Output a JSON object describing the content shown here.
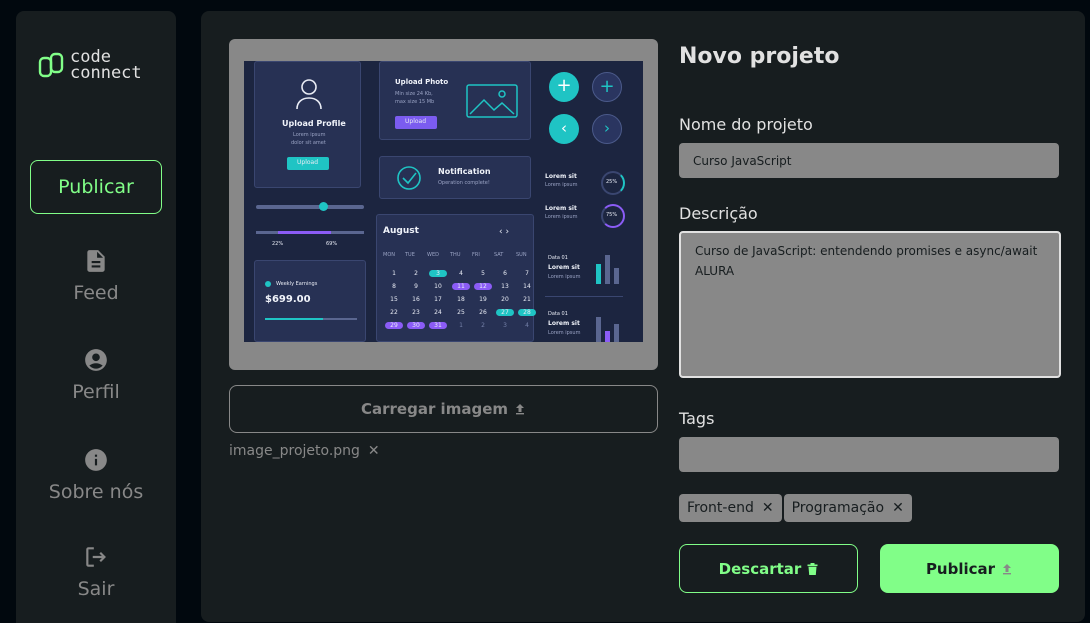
{
  "sidebar": {
    "logo_line1": "code",
    "logo_line2": "connect",
    "publish_label": "Publicar",
    "items": [
      {
        "label": "Feed",
        "icon": "document-icon"
      },
      {
        "label": "Perfil",
        "icon": "user-circle-icon"
      },
      {
        "label": "Sobre nós",
        "icon": "info-icon"
      },
      {
        "label": "Sair",
        "icon": "logout-icon"
      }
    ]
  },
  "preview": {
    "upload_label": "Carregar imagem",
    "file_name": "image_projeto.png",
    "mockup": {
      "upload_profile": "Upload Profile",
      "profile_desc1": "Lorem ipsum",
      "profile_desc2": "dolor sit amet",
      "upload_btn": "Upload",
      "upload_photo": "Upload Photo",
      "min_size": "Min size 24 Kb,",
      "max_size": "max size 15 Mb",
      "upload_btn2": "Upload",
      "notification": "Notification",
      "operation_complete": "Operation complete!",
      "slider_low": "22%",
      "slider_high": "69%",
      "weekly_earnings": "Weekly Earnings",
      "amount": "$699.00",
      "calendar_month": "August",
      "weekdays": [
        "MON",
        "TUE",
        "WED",
        "THU",
        "FRI",
        "SAT",
        "SUN"
      ],
      "calendar_rows": [
        [
          "1",
          "2",
          "3",
          "4",
          "5",
          "6",
          "7"
        ],
        [
          "8",
          "9",
          "10",
          "11",
          "12",
          "13",
          "14"
        ],
        [
          "15",
          "16",
          "17",
          "18",
          "19",
          "20",
          "21"
        ],
        [
          "22",
          "23",
          "24",
          "25",
          "26",
          "27",
          "28"
        ],
        [
          "29",
          "30",
          "31",
          "1",
          "2",
          "3",
          "4"
        ]
      ],
      "stat1_title": "Lorem sit",
      "stat1_sub": "Lorem ipsum",
      "stat1_value": "25%",
      "stat2_title": "Lorem sit",
      "stat2_sub": "Lorem ipsum",
      "stat2_value": "75%",
      "data1_label": "Data 01",
      "data1_title": "Lorem sit",
      "data1_sub": "Lorem ipsum",
      "data2_label": "Data 01",
      "data2_title": "Lorem sit",
      "data2_sub": "Lorem ipsum"
    }
  },
  "form": {
    "title": "Novo projeto",
    "name_label": "Nome do projeto",
    "name_value": "Curso JavaScript",
    "description_label": "Descrição",
    "description_value": "Curso de JavaScript: entendendo promises e async/await\nALURA",
    "tags_label": "Tags",
    "tags_value": "",
    "tags": [
      "Front-end",
      "Programação"
    ],
    "discard_label": "Descartar",
    "publish_label": "Publicar"
  },
  "colors": {
    "accent": "#81fe88",
    "panel": "#171d1f",
    "background": "#01080e",
    "muted": "#888888"
  }
}
